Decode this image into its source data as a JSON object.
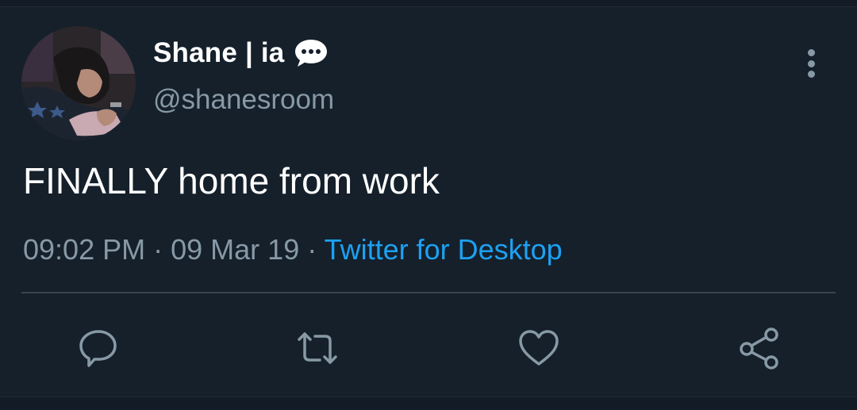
{
  "tweet": {
    "display_name": "Shane | ia",
    "name_emoji_icon": "speech-bubble-icon",
    "handle": "@shanesroom",
    "text": "FINALLY home from work",
    "time": "09:02 PM",
    "separator": "·",
    "date": "09 Mar 19",
    "source": "Twitter for Desktop"
  },
  "actions": {
    "reply_icon": "reply-icon",
    "retweet_icon": "retweet-icon",
    "like_icon": "heart-icon",
    "share_icon": "share-icon",
    "more_icon": "more-vertical-icon"
  },
  "colors": {
    "background": "#15202b",
    "text_primary": "#ffffff",
    "text_secondary": "#8899a6",
    "link": "#1da1f2",
    "divider": "#38444d"
  }
}
